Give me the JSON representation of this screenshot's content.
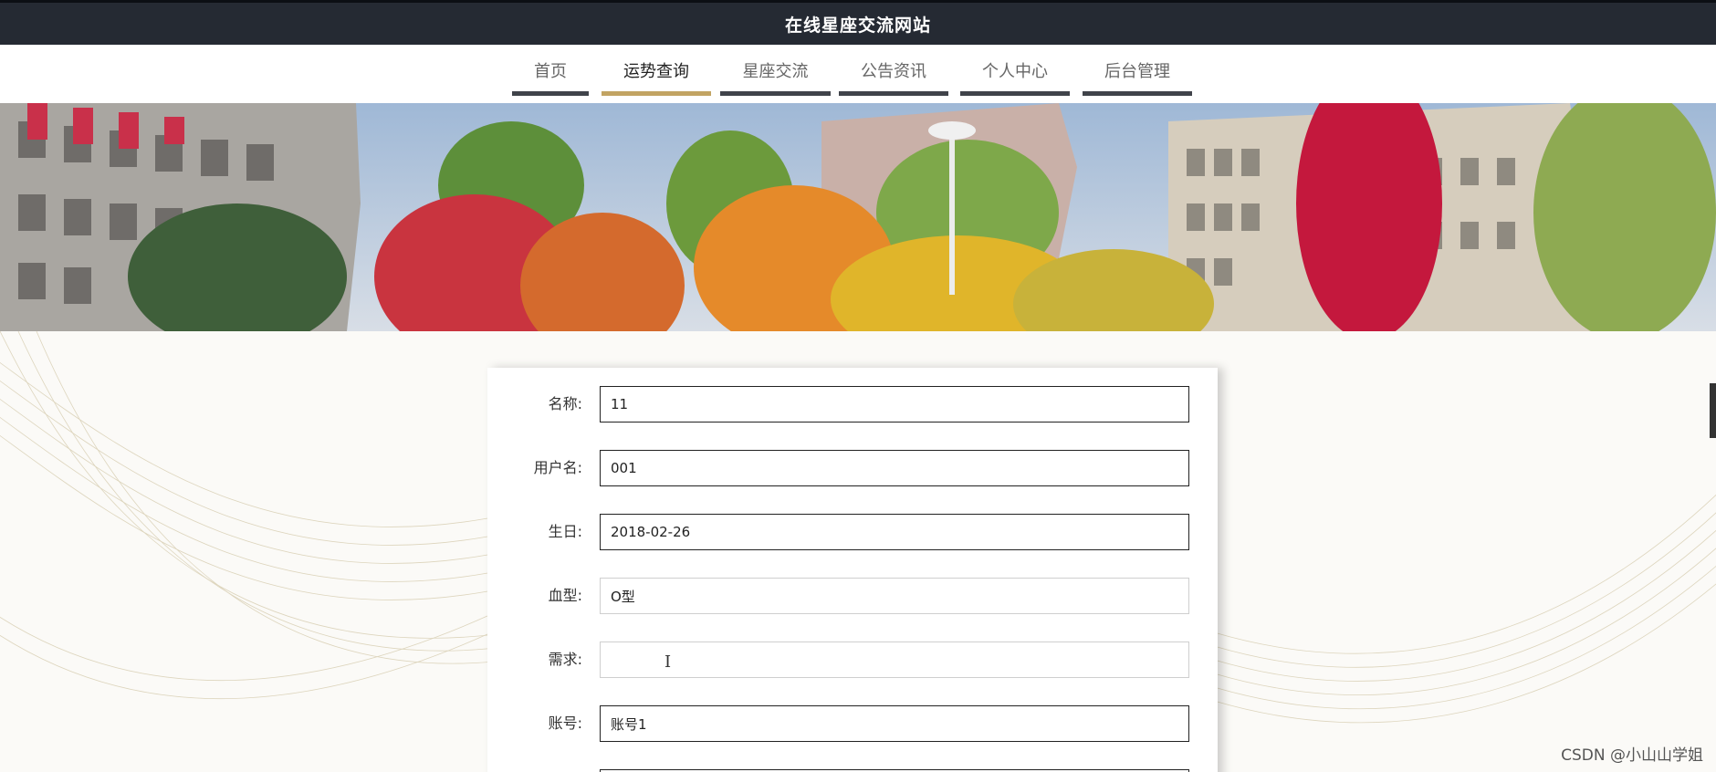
{
  "header": {
    "site_title": "在线星座交流网站"
  },
  "nav": {
    "items": [
      {
        "label": "首页",
        "active": false
      },
      {
        "label": "运势查询",
        "active": true
      },
      {
        "label": "星座交流",
        "active": false
      },
      {
        "label": "公告资讯",
        "active": false
      },
      {
        "label": "个人中心",
        "active": false
      },
      {
        "label": "后台管理",
        "active": false
      }
    ]
  },
  "form": {
    "fields": [
      {
        "label": "名称:",
        "value": "11"
      },
      {
        "label": "用户名:",
        "value": "001"
      },
      {
        "label": "生日:",
        "value": "2018-02-26"
      },
      {
        "label": "血型:",
        "value": "O型"
      },
      {
        "label": "需求:",
        "value": ""
      },
      {
        "label": "账号:",
        "value": "账号1"
      }
    ]
  },
  "watermark": "CSDN @小山山学姐",
  "colors": {
    "topbar_bg": "#252a33",
    "nav_active_underline": "#c2a463",
    "nav_underline": "#40434a"
  }
}
